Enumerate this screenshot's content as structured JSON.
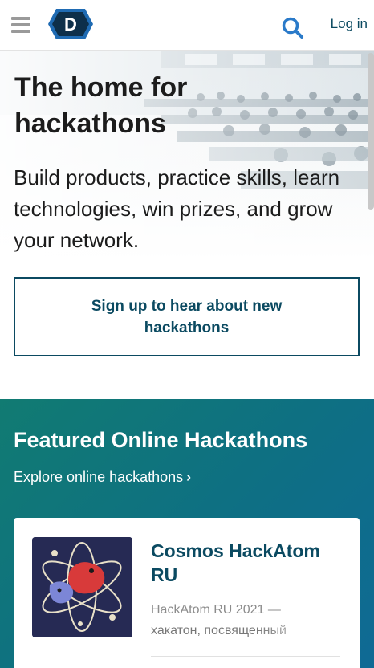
{
  "header": {
    "login_label": "Log in",
    "logo_letter": "D"
  },
  "hero": {
    "title": "The home for hackathons",
    "subtitle": "Build products, practice skills, learn technologies, win prizes, and grow your network.",
    "signup_button": "Sign up to hear about new hackathons"
  },
  "featured": {
    "title": "Featured Online Hackathons",
    "explore_link": "Explore online hackathons",
    "card": {
      "title": "Cosmos HackAtom RU",
      "description_line1": "HackAtom RU 2021 —",
      "description_line2": "хакатон, посвященный"
    }
  },
  "colors": {
    "brand": "#0b4a61",
    "logo_blue": "#1f6bb3",
    "search_blue": "#2a7ac9",
    "featured_teal": "#117b72",
    "featured_blue": "#0f6a95",
    "thumb_navy": "#262a54"
  },
  "icons": {
    "menu": "hamburger-icon",
    "search": "search-icon",
    "explore": "chevron-right-icon"
  }
}
